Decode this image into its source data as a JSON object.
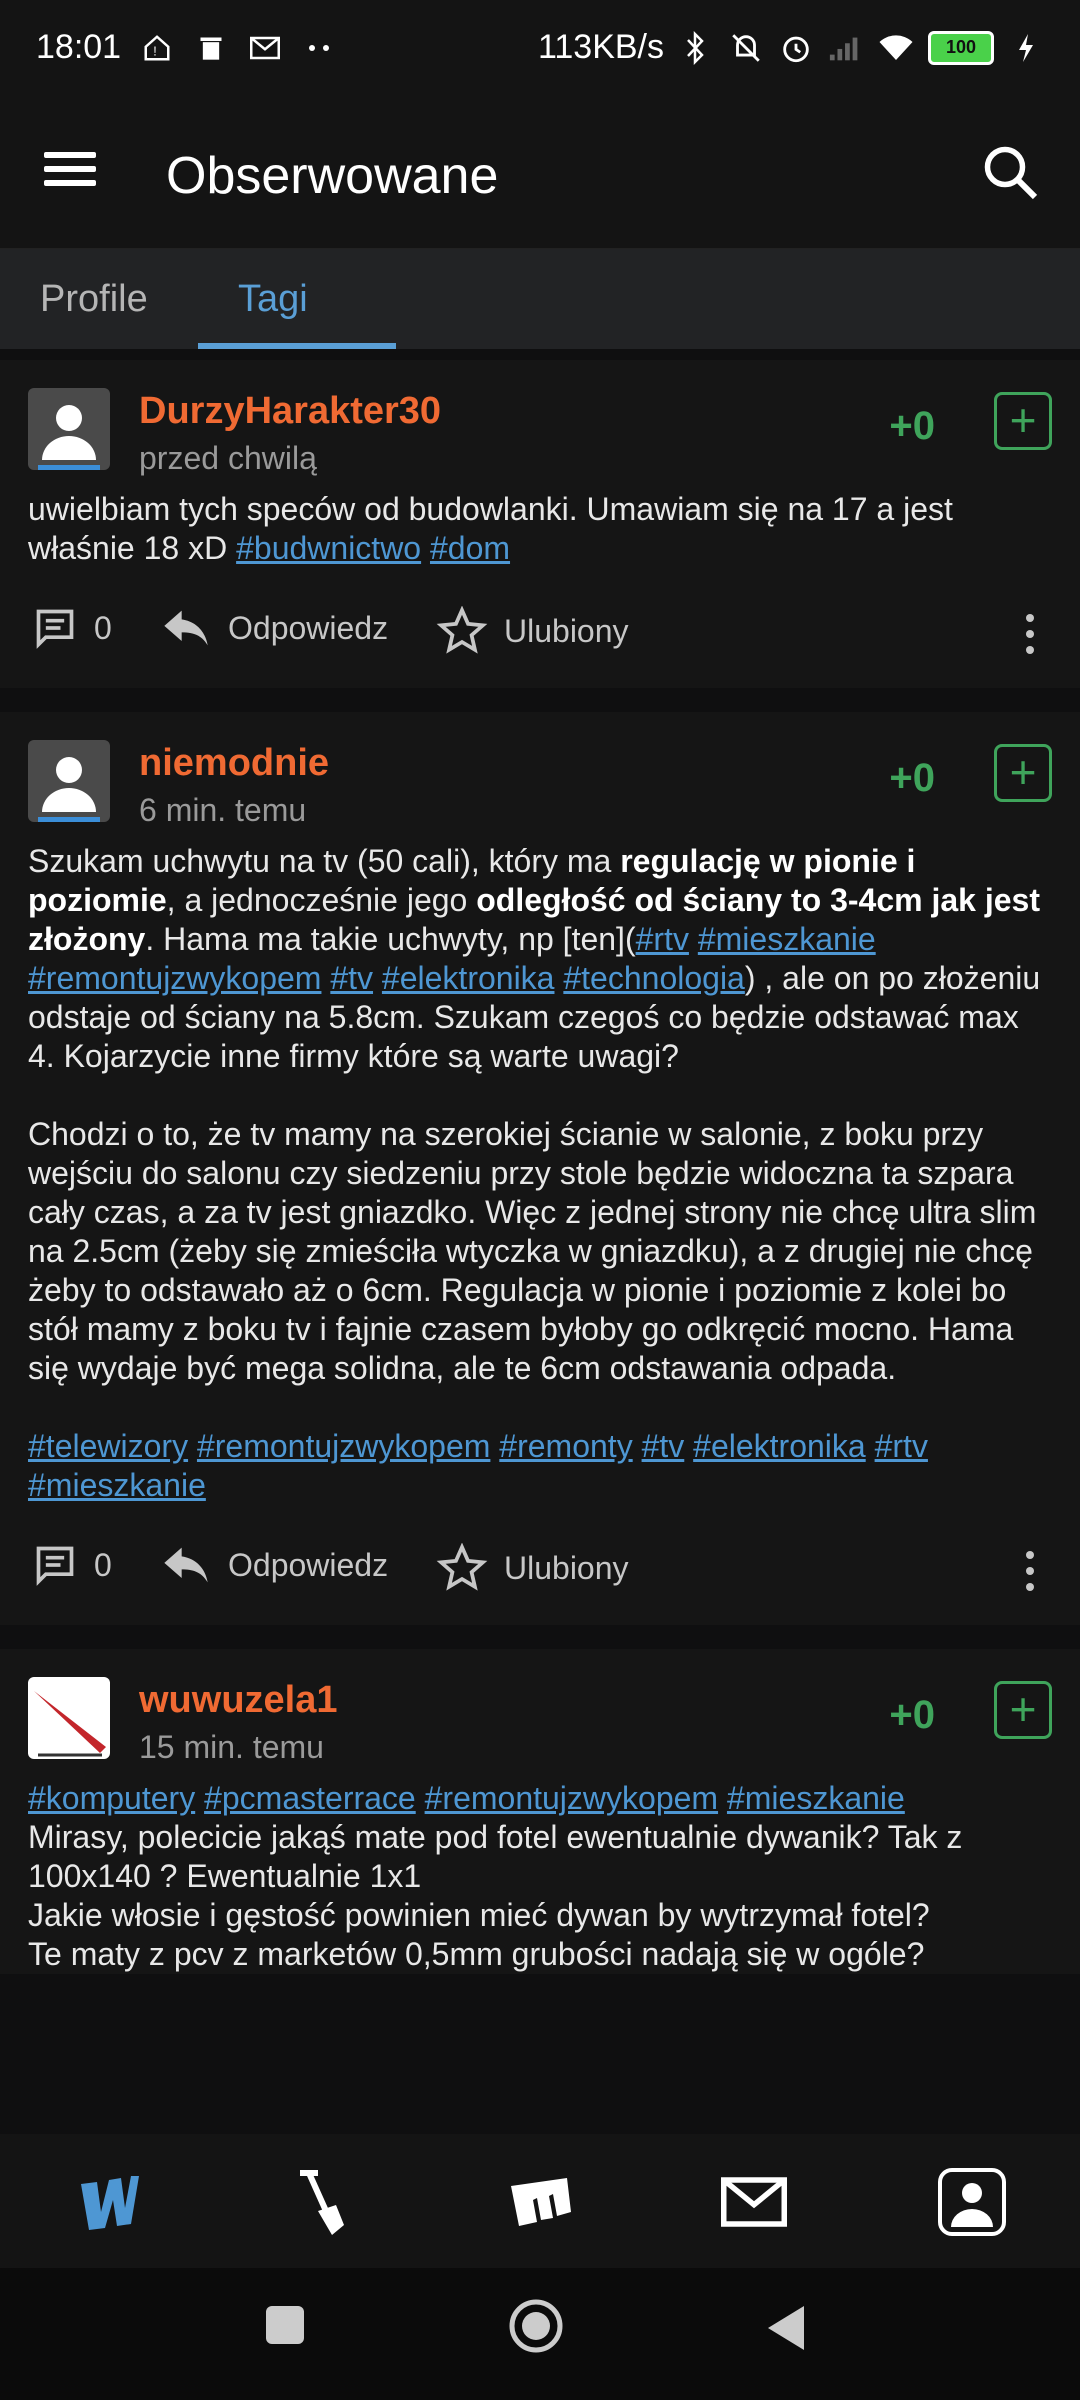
{
  "status_bar": {
    "time": "18:01",
    "net_speed": "113KB/s",
    "battery": "100",
    "icons": [
      "home-alert-icon",
      "trash-icon",
      "mail-icon",
      "more-dots-icon",
      "bluetooth-icon",
      "mute-icon",
      "alarm-icon",
      "signal-icon",
      "wifi-icon",
      "battery-icon",
      "charging-icon"
    ]
  },
  "app_bar": {
    "title": "Obserwowane",
    "menu_icon": "hamburger-icon",
    "search_icon": "search-icon"
  },
  "tabs": [
    {
      "label": "Profile",
      "active": false
    },
    {
      "label": "Tagi",
      "active": true
    }
  ],
  "colors": {
    "username": "#f06a33",
    "tag": "#4e97d3",
    "votes": "#3fa45b",
    "tab_active": "#5a9fd6"
  },
  "posts": [
    {
      "username": "DurzyHarakter30",
      "time": "przed chwilą",
      "votes": "+0",
      "body_text": "uwielbiam tych speców od budowlanki. Umawiam się na 17 a jest właśnie 18 xD",
      "tags": [
        "#budwnictwo",
        "#dom"
      ],
      "comments": "0",
      "reply_label": "Odpowiedz",
      "fav_label": "Ulubiony"
    },
    {
      "username": "niemodnie",
      "time": "6 min. temu",
      "votes": "+0",
      "p1_a": "Szukam uchwytu na tv (50 cali), który ma ",
      "p1_b": "regulację w pionie i poziomie",
      "p1_c": ", a jednocześnie jego ",
      "p1_d": "odległość od ściany to 3-4cm jak jest złożony",
      "p1_e": ". Hama ma takie uchwyty, np [ten](",
      "p1_tags": [
        "#rtv",
        "#mieszkanie",
        "#remontujzwykopem",
        "#tv",
        "#elektronika",
        "#technologia"
      ],
      "p1_f": ") , ale on po złożeniu odstaje od ściany na 5.8cm. Szukam czegoś co będzie odstawać max 4. Kojarzycie inne firmy które są warte uwagi?",
      "p2": "Chodzi o to, że tv mamy na szerokiej ścianie w salonie, z boku przy wejściu do salonu czy siedzeniu przy stole będzie widoczna ta szpara cały czas, a za tv jest gniazdko. Więc z jednej strony nie chcę ultra slim na 2.5cm (żeby się zmieściła wtyczka w gniazdku), a z drugiej nie chcę żeby to odstawało aż o 6cm. Regulacja w pionie i poziomie z kolei bo stół mamy z boku tv i fajnie czasem byłoby go odkręcić mocno. Hama się wydaje być mega solidna, ale te 6cm odstawania odpada.",
      "tags": [
        "#telewizory",
        "#remontujzwykopem",
        "#remonty",
        "#tv",
        "#elektronika",
        "#rtv",
        "#mieszkanie"
      ],
      "comments": "0",
      "reply_label": "Odpowiedz",
      "fav_label": "Ulubiony"
    },
    {
      "username": "wuwuzela1",
      "time": "15 min. temu",
      "votes": "+0",
      "tags": [
        "#komputery",
        "#pcmasterrace",
        "#remontujzwykopem",
        "#mieszkanie"
      ],
      "line1": "Mirasy, polecicie jakąś mate pod fotel ewentualnie dywanik? Tak  z 100x140 ? Ewentualnie 1x1",
      "line2": "Jakie włosie i gęstość powinien mieć dywan by wytrzymał fotel?",
      "line3": "Te maty z pcv z marketów 0,5mm grubości nadają się w ogóle?"
    }
  ],
  "bottom_nav": [
    "wykop-home-icon",
    "shovel-icon",
    "mikroblog-icon",
    "mail-icon",
    "profile-icon"
  ],
  "system_nav": [
    "recents-square-icon",
    "home-circle-icon",
    "back-triangle-icon"
  ]
}
